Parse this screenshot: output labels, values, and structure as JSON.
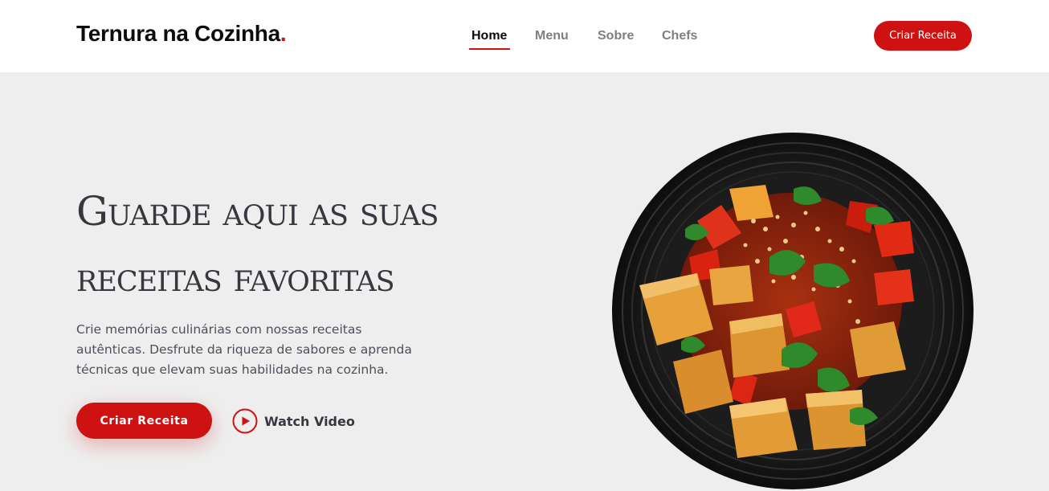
{
  "header": {
    "logo_text": "Ternura na Cozinha",
    "logo_dot": ".",
    "nav": [
      {
        "label": "Home",
        "active": true
      },
      {
        "label": "Menu",
        "active": false
      },
      {
        "label": "Sobre",
        "active": false
      },
      {
        "label": "Chefs",
        "active": false
      }
    ],
    "cta_label": "Criar Receita"
  },
  "hero": {
    "title_line1": "Guarde aqui as suas",
    "title_line2": "receitas favoritas",
    "description": "Crie memórias culinárias com nossas receitas autênticas. Desfrute da riqueza de sabores e aprenda técnicas que elevam suas habilidades na cozinha.",
    "primary_button": "Criar Receita",
    "video_label": "Watch Video",
    "video_icon": "play-circle-icon",
    "image": "dish-image"
  },
  "colors": {
    "accent": "#ce1212",
    "hero_background": "#eeeeee",
    "heading": "#37373f",
    "nav_inactive": "#7f7f7f"
  }
}
